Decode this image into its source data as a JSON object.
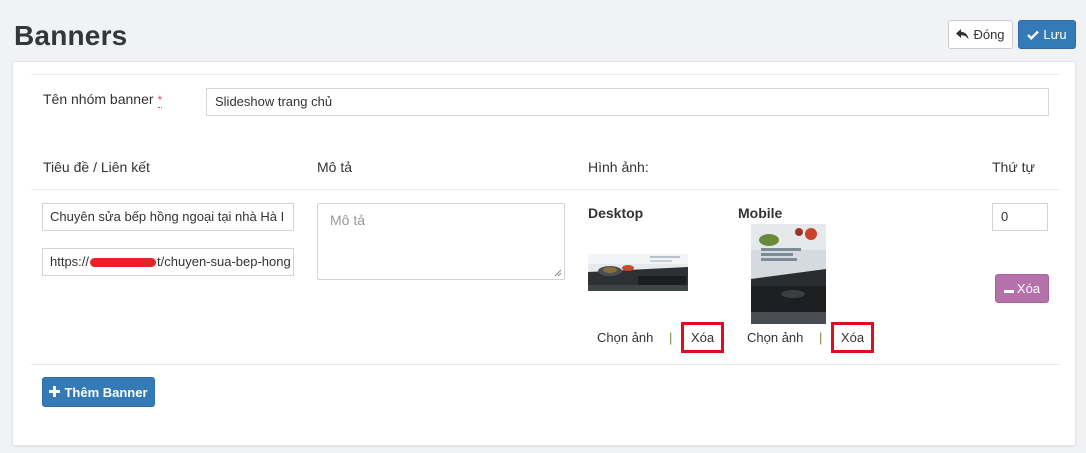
{
  "header": {
    "title": "Banners",
    "close_label": "Đóng",
    "save_label": "Lưu"
  },
  "form": {
    "group_label": "Tên nhóm banner",
    "required_mark": "*",
    "group_value": "Slideshow trang chủ"
  },
  "table": {
    "col_title": "Tiêu đề / Liên kết",
    "col_desc": "Mô tả",
    "col_image": "Hình ảnh:",
    "col_order": "Thứ tự"
  },
  "row": {
    "title_value": "Chuyên sửa bếp hồng ngoại tại nhà Hà I",
    "link_prefix": "https://",
    "link_suffix": "t/chuyen-sua-bep-hong",
    "desc_placeholder": "Mô tả",
    "desktop_label": "Desktop",
    "mobile_label": "Mobile",
    "choose_label": "Chọn ảnh",
    "separator": "|",
    "delete_image_label": "Xóa",
    "order_value": "0",
    "delete_row_label": "Xóa"
  },
  "footer": {
    "add_label": "Thêm Banner"
  },
  "colors": {
    "primary": "#337ab7",
    "delete_row": "#b571a9",
    "highlight_box": "#e00d1c",
    "redaction": "#e8212b"
  },
  "icons": {
    "close": "reply-arrow-icon",
    "save": "check-icon",
    "delete_row": "minus-icon",
    "add": "plus-icon"
  }
}
